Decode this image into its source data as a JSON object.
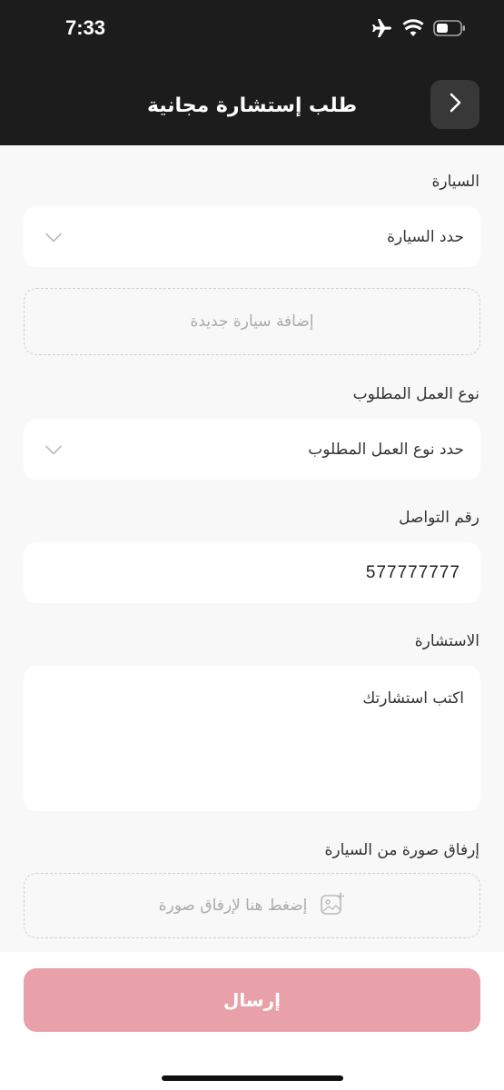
{
  "status_bar": {
    "time": "7:33"
  },
  "header": {
    "title": "طلب إستشارة مجانية",
    "back_icon": "chevron-right-icon"
  },
  "form": {
    "car": {
      "label": "السيارة",
      "placeholder": "حدد السيارة",
      "add_new": "إضافة سيارة جديدة"
    },
    "work_type": {
      "label": "نوع العمل المطلوب",
      "placeholder": "حدد نوع العمل المطلوب"
    },
    "contact": {
      "label": "رقم التواصل",
      "value": "577777777"
    },
    "consultation": {
      "label": "الاستشارة",
      "placeholder": "اكتب استشارتك"
    },
    "attachment": {
      "label": "إرفاق صورة من السيارة",
      "hint": "إضغط هنا لإرفاق صورة"
    }
  },
  "submit": {
    "label": "إرسال",
    "color": "#e8a1a8"
  }
}
